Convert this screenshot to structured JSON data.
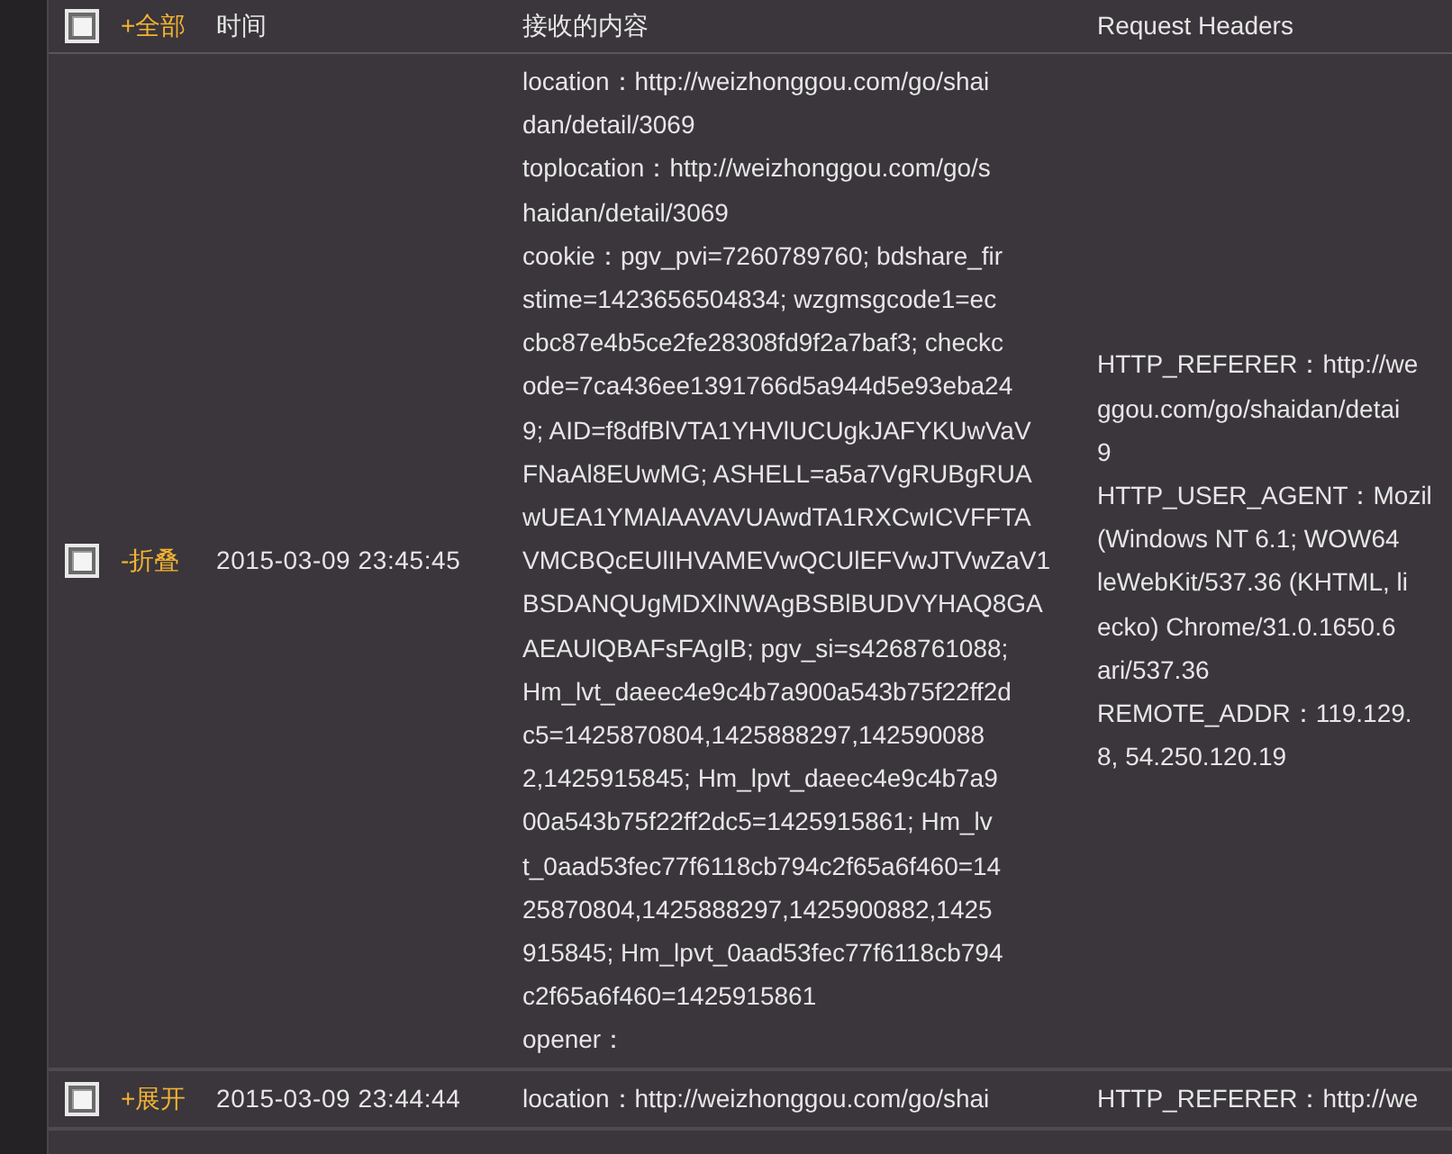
{
  "header": {
    "select_all": {
      "checked": false
    },
    "toggle_all": "+全部",
    "columns": [
      "时间",
      "接收的内容",
      "Request Headers"
    ]
  },
  "rows": [
    {
      "checked": false,
      "toggle": "-折叠",
      "expanded": true,
      "time": "2015-03-09 23:45:45",
      "content": [
        "location：http://weizhonggou.com/go/shai",
        "dan/detail/3069",
        "toplocation：http://weizhonggou.com/go/s",
        "haidan/detail/3069",
        "cookie：pgv_pvi=7260789760; bdshare_fir",
        "stime=1423656504834; wzgmsgcode1=ec",
        "cbc87e4b5ce2fe28308fd9f2a7baf3; checkc",
        "ode=7ca436ee1391766d5a944d5e93eba24",
        "9; AID=f8dfBlVTA1YHVlUCUgkJAFYKUwVaV",
        "FNaAl8EUwMG; ASHELL=a5a7VgRUBgRUA",
        "wUEA1YMAlAAVAVUAwdTA1RXCwICVFFTA",
        "VMCBQcEUlIHVAMEVwQCUlEFVwJTVwZaV1",
        "BSDANQUgMDXlNWAgBSBlBUDVYHAQ8GA",
        "AEAUlQBAFsFAgIB; pgv_si=s4268761088;",
        "Hm_lvt_daeec4e9c4b7a900a543b75f22ff2d",
        "c5=1425870804,1425888297,142590088",
        "2,1425915845; Hm_lpvt_daeec4e9c4b7a9",
        "00a543b75f22ff2dc5=1425915861; Hm_lv",
        "t_0aad53fec77f6118cb794c2f65a6f460=14",
        "25870804,1425888297,1425900882,1425",
        "915845; Hm_lpvt_0aad53fec77f6118cb794",
        "c2f65a6f460=1425915861",
        "opener："
      ],
      "headers": [
        "HTTP_REFERER：http://we",
        "ggou.com/go/shaidan/detai",
        "9",
        "HTTP_USER_AGENT：Mozil",
        "(Windows NT 6.1; WOW64",
        "leWebKit/537.36 (KHTML, li",
        "ecko) Chrome/31.0.1650.6",
        "ari/537.36",
        "REMOTE_ADDR：119.129.",
        "8, 54.250.120.19"
      ]
    },
    {
      "checked": false,
      "toggle": "+展开",
      "expanded": false,
      "time": "2015-03-09 23:44:44",
      "content": [
        "location：http://weizhonggou.com/go/shai"
      ],
      "headers": [
        "HTTP_REFERER：http://we"
      ]
    }
  ]
}
